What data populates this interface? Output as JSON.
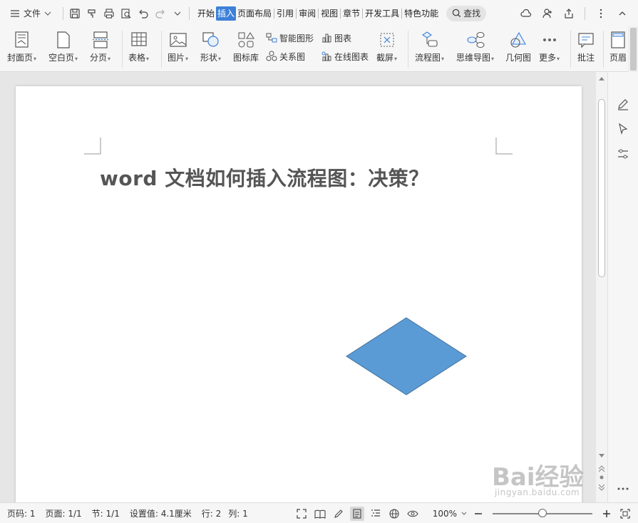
{
  "menubar": {
    "file_label": "文件",
    "tabs": [
      {
        "label": "开始",
        "active": false
      },
      {
        "label": "插入",
        "active": true
      },
      {
        "label": "页面布局",
        "active": false
      },
      {
        "label": "引用",
        "active": false
      },
      {
        "label": "审阅",
        "active": false
      },
      {
        "label": "视图",
        "active": false
      },
      {
        "label": "章节",
        "active": false
      },
      {
        "label": "开发工具",
        "active": false
      },
      {
        "label": "特色功能",
        "active": false
      }
    ],
    "search_label": "查找"
  },
  "ribbon": {
    "cover": "封面页",
    "blank": "空白页",
    "pagebreak": "分页",
    "table": "表格",
    "picture": "图片",
    "shape": "形状",
    "iconlib": "图标库",
    "smartart": "智能图形",
    "chart": "图表",
    "relation": "关系图",
    "online_chart": "在线图表",
    "screenshot": "截屏",
    "flowchart": "流程图",
    "mindmap": "思维导图",
    "geometry": "几何图",
    "more": "更多",
    "comment": "批注",
    "header": "页眉"
  },
  "document": {
    "title": "word 文档如何插入流程图：决策？",
    "shape": {
      "type": "diamond",
      "fill": "#5b9bd5",
      "stroke": "#41719c"
    }
  },
  "statusbar": {
    "page_no": "页码: 1",
    "pages": "页面: 1/1",
    "section": "节: 1/1",
    "setting": "设置值: 4.1厘米",
    "row": "行: 2",
    "col": "列: 1",
    "zoom": "100%"
  },
  "watermark": {
    "brand": "Bai经验",
    "site": "jingyan.baidu.com"
  },
  "colors": {
    "accent": "#3d80d8",
    "shape_fill": "#5b9bd5"
  }
}
